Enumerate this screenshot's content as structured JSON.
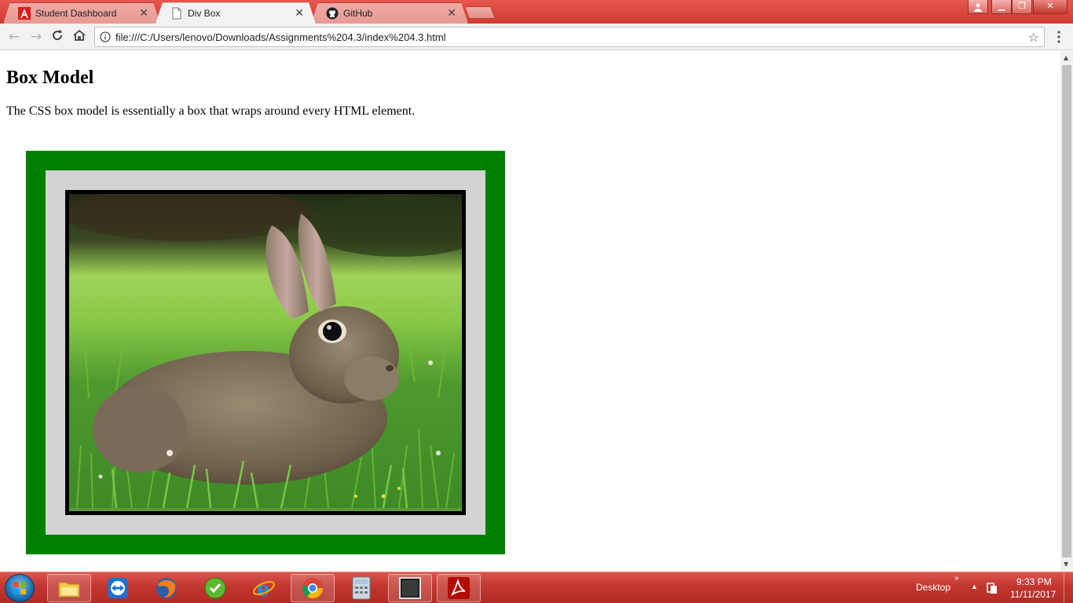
{
  "browser": {
    "tabs": [
      {
        "title": "Student Dashboard",
        "icon": "angular-icon",
        "active": false
      },
      {
        "title": "Div Box",
        "icon": "page-icon",
        "active": true
      },
      {
        "title": "GitHub",
        "icon": "github-icon",
        "active": false
      }
    ],
    "url": "file:///C:/Users/lenovo/Downloads/Assignments%204.3/index%204.3.html",
    "colors": {
      "titlebar": "#d9443c",
      "toolbar": "#f2f2f2"
    }
  },
  "page": {
    "heading": "Box Model",
    "paragraph": "The CSS box model is essentially a box that wraps around every HTML element.",
    "colors": {
      "outer_border": "#008000",
      "padding": "#d3d3d3",
      "image_border": "#000000"
    }
  },
  "taskbar": {
    "items": [
      "windows-explorer-icon",
      "teamviewer-icon",
      "firefox-icon",
      "greenshot-icon",
      "internet-explorer-icon",
      "chrome-icon",
      "calculator-icon",
      "terminal-icon",
      "acrobat-icon"
    ],
    "desktop_label": "Desktop",
    "time": "9:33 PM",
    "date": "11/11/2017"
  }
}
